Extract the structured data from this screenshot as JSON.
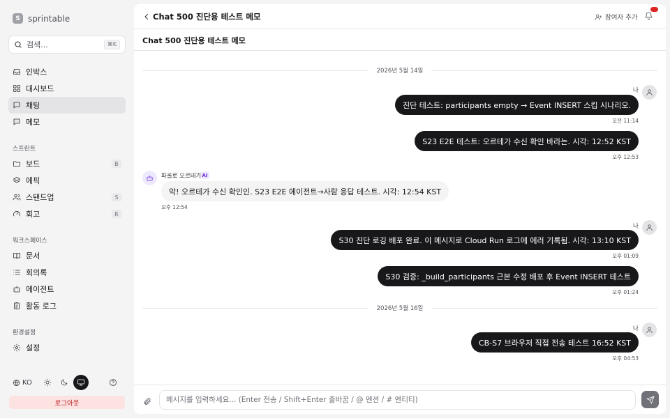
{
  "sidebar": {
    "brand": {
      "initial": "S",
      "name": "sprintable"
    },
    "search": {
      "placeholder": "검색...",
      "shortcut": "⌘K"
    },
    "primary_items": [
      {
        "label": "인박스",
        "icon": "inbox-icon"
      },
      {
        "label": "대시보드",
        "icon": "dashboard-icon"
      },
      {
        "label": "채팅",
        "icon": "chat-icon",
        "active": true
      },
      {
        "label": "메모",
        "icon": "memo-icon"
      }
    ],
    "sections": {
      "sprint": "스프린트",
      "workspace": "워크스페이스",
      "settings": "환경설정"
    },
    "sprint_items": [
      {
        "label": "보드",
        "icon": "folder-icon",
        "shortcut": "B"
      },
      {
        "label": "에픽",
        "icon": "layers-icon"
      },
      {
        "label": "스탠드업",
        "icon": "users-icon",
        "shortcut": "S"
      },
      {
        "label": "회고",
        "icon": "gauge-icon",
        "shortcut": "R"
      }
    ],
    "workspace_items": [
      {
        "label": "문서",
        "icon": "book-icon"
      },
      {
        "label": "회의록",
        "icon": "list-icon"
      },
      {
        "label": "에이전트",
        "icon": "bot-icon"
      },
      {
        "label": "활동 로그",
        "icon": "clipboard-icon"
      }
    ],
    "settings_items": [
      {
        "label": "설정",
        "icon": "gear-icon"
      }
    ],
    "footer": {
      "language": "KO",
      "logout": "로그아웃"
    }
  },
  "header": {
    "title": "Chat 500 진단용 테스트 메모",
    "add_participant": "참여자 추가"
  },
  "chat": {
    "title": "Chat 500 진단용 테스트 메모",
    "date_separators": [
      "2026년 5월 14일",
      "2026년 5월 16일"
    ],
    "my_sender": "나",
    "agent_sender": "파울로 오르테가",
    "ai_badge": "AI",
    "messages": [
      {
        "mine": true,
        "text": "진단 테스트: participants empty → Event INSERT 스킵 시나리오.",
        "time": "오전 11:14"
      },
      {
        "mine": true,
        "text": "S23 E2E 테스트: 오르테가 수신 확인 바라는. 시각: 12:52 KST",
        "time": "오후 12:53"
      },
      {
        "mine": false,
        "text": "악! 오르테가 수신 확인인. S23 E2E 에이전트→사람 응답 테스트. 시각: 12:54 KST",
        "time": "오후 12:54"
      },
      {
        "mine": true,
        "text": "S30 진단 로깅 배포 완료. 이 메시지로 Cloud Run 로그에 에러 기록됨. 시각: 13:10 KST",
        "time": "오후 01:09"
      },
      {
        "mine": true,
        "text": "S30 검증: _build_participants 근본 수정 배포 후 Event INSERT 테스트",
        "time": "오후 01:24"
      },
      {
        "mine": true,
        "text": "CB-S7 브라우저 직접 전송 테스트 16:52 KST",
        "time": "오후 04:53"
      }
    ]
  },
  "composer": {
    "placeholder": "메시지를 입력하세요... (Enter 전송 / Shift+Enter 줄바꿈 / @ 멘션 / # 엔티티)"
  }
}
